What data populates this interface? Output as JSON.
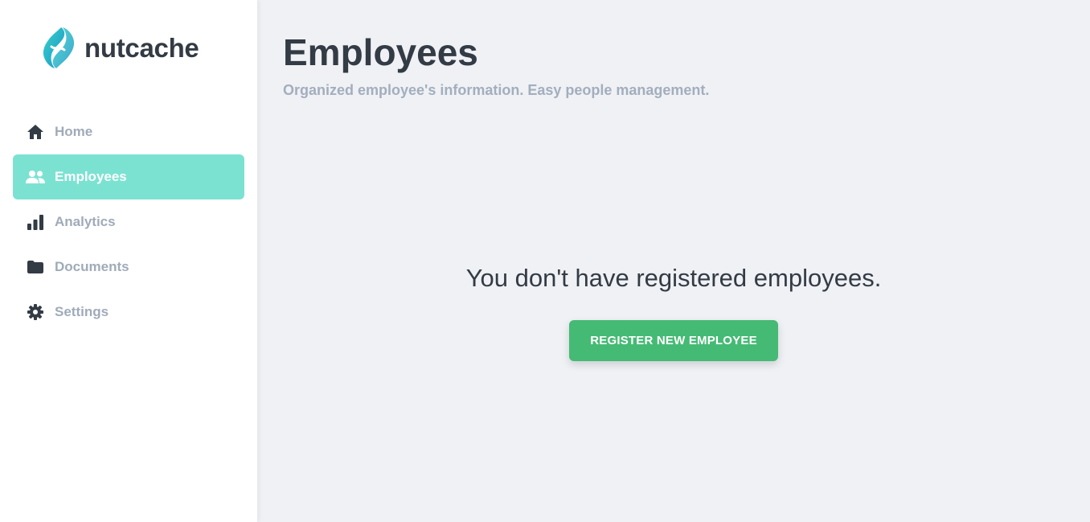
{
  "brand": {
    "name": "nutcache",
    "logo_icon": "nutcache-logo-icon",
    "accent": "#1bb9c4"
  },
  "sidebar": {
    "active_color": "#7be2d2",
    "items": [
      {
        "label": "Home",
        "icon": "home-icon",
        "active": false
      },
      {
        "label": "Employees",
        "icon": "users-icon",
        "active": true
      },
      {
        "label": "Analytics",
        "icon": "bar-chart-icon",
        "active": false
      },
      {
        "label": "Documents",
        "icon": "folder-icon",
        "active": false
      },
      {
        "label": "Settings",
        "icon": "gear-icon",
        "active": false
      }
    ]
  },
  "main": {
    "title": "Employees",
    "subtitle": "Organized employee's information. Easy people management.",
    "empty_message": "You don't have registered employees.",
    "register_button_label": "REGISTER NEW EMPLOYEE",
    "button_color": "#45ba74"
  }
}
